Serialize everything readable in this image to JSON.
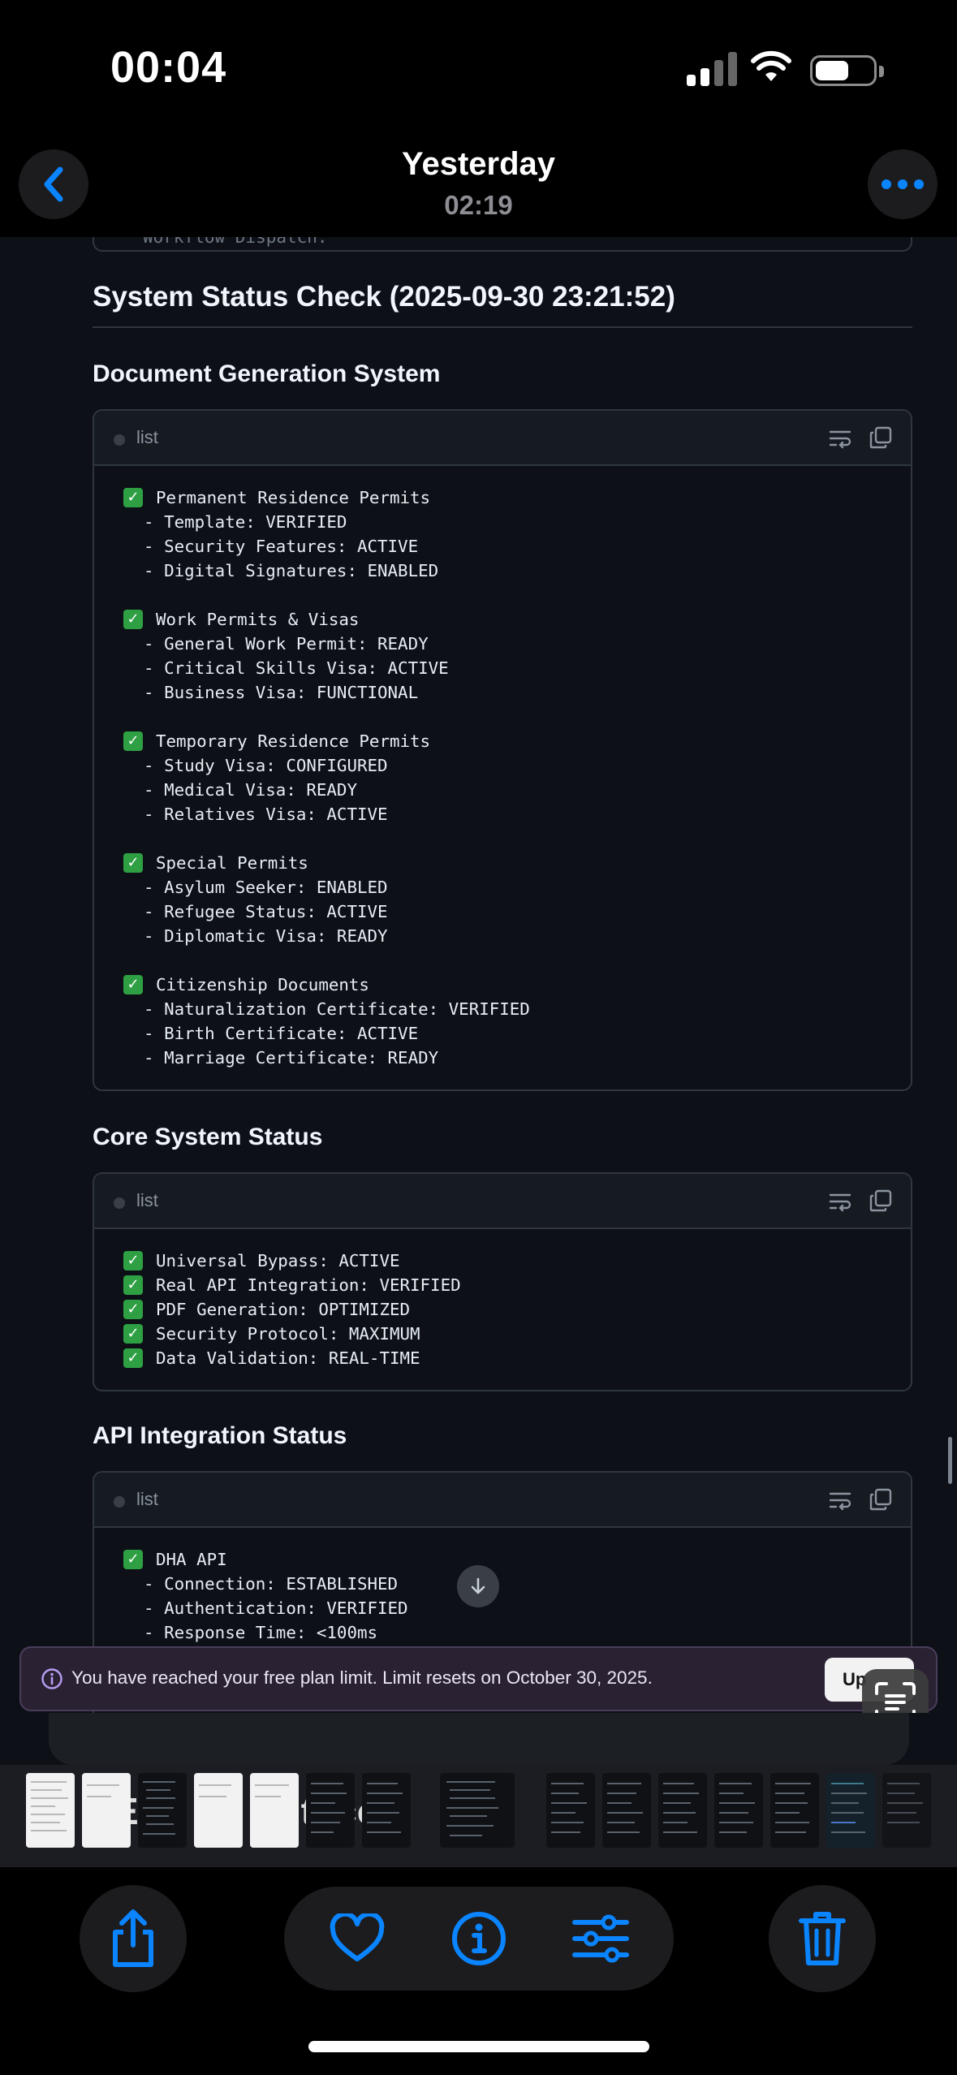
{
  "status_bar": {
    "time": "00:04"
  },
  "header": {
    "title": "Yesterday",
    "subtitle": "02:19"
  },
  "content": {
    "truncated_prev_text": "Workflow Dispatch:",
    "section_title": "System Status Check (2025-09-30 23:21:52)",
    "blocks": [
      {
        "heading": "Document Generation System",
        "lang": "list",
        "lines": [
          {
            "check": true,
            "text": "Permanent Residence Permits"
          },
          {
            "check": false,
            "text": "  - Template: VERIFIED"
          },
          {
            "check": false,
            "text": "  - Security Features: ACTIVE"
          },
          {
            "check": false,
            "text": "  - Digital Signatures: ENABLED"
          },
          {
            "check": false,
            "text": ""
          },
          {
            "check": true,
            "text": "Work Permits & Visas"
          },
          {
            "check": false,
            "text": "  - General Work Permit: READY"
          },
          {
            "check": false,
            "text": "  - Critical Skills Visa: ACTIVE"
          },
          {
            "check": false,
            "text": "  - Business Visa: FUNCTIONAL"
          },
          {
            "check": false,
            "text": ""
          },
          {
            "check": true,
            "text": "Temporary Residence Permits"
          },
          {
            "check": false,
            "text": "  - Study Visa: CONFIGURED"
          },
          {
            "check": false,
            "text": "  - Medical Visa: READY"
          },
          {
            "check": false,
            "text": "  - Relatives Visa: ACTIVE"
          },
          {
            "check": false,
            "text": ""
          },
          {
            "check": true,
            "text": "Special Permits"
          },
          {
            "check": false,
            "text": "  - Asylum Seeker: ENABLED"
          },
          {
            "check": false,
            "text": "  - Refugee Status: ACTIVE"
          },
          {
            "check": false,
            "text": "  - Diplomatic Visa: READY"
          },
          {
            "check": false,
            "text": ""
          },
          {
            "check": true,
            "text": "Citizenship Documents"
          },
          {
            "check": false,
            "text": "  - Naturalization Certificate: VERIFIED"
          },
          {
            "check": false,
            "text": "  - Birth Certificate: ACTIVE"
          },
          {
            "check": false,
            "text": "  - Marriage Certificate: READY"
          }
        ]
      },
      {
        "heading": "Core System Status",
        "lang": "list",
        "lines": [
          {
            "check": true,
            "text": "Universal Bypass: ACTIVE"
          },
          {
            "check": true,
            "text": "Real API Integration: VERIFIED"
          },
          {
            "check": true,
            "text": "PDF Generation: OPTIMIZED"
          },
          {
            "check": true,
            "text": "Security Protocol: MAXIMUM"
          },
          {
            "check": true,
            "text": "Data Validation: REAL-TIME"
          }
        ]
      },
      {
        "heading": "API Integration Status",
        "lang": "list",
        "lines": [
          {
            "check": true,
            "text": "DHA API"
          },
          {
            "check": false,
            "text": "  - Connection: ESTABLISHED"
          },
          {
            "check": false,
            "text": "  - Authentication: VERIFIED"
          },
          {
            "check": false,
            "text": "  - Response Time: <100ms"
          }
        ]
      }
    ]
  },
  "banner": {
    "message": "You have reached your free plan limit. Limit resets on October 30, 2025.",
    "button_label": "Up"
  },
  "thumbnail_strip": {
    "ghost_text_a": "E",
    "ghost_text_b": "th",
    "ghost_text_c": "co"
  },
  "toolbar": {
    "icons": [
      "share-icon",
      "heart-icon",
      "info-icon",
      "adjust-icon",
      "trash-icon"
    ]
  },
  "colors": {
    "accent": "#0a84ff",
    "check_green": "#2ea043",
    "code_bg": "#0d1117",
    "banner_bg": "#2a2233"
  }
}
